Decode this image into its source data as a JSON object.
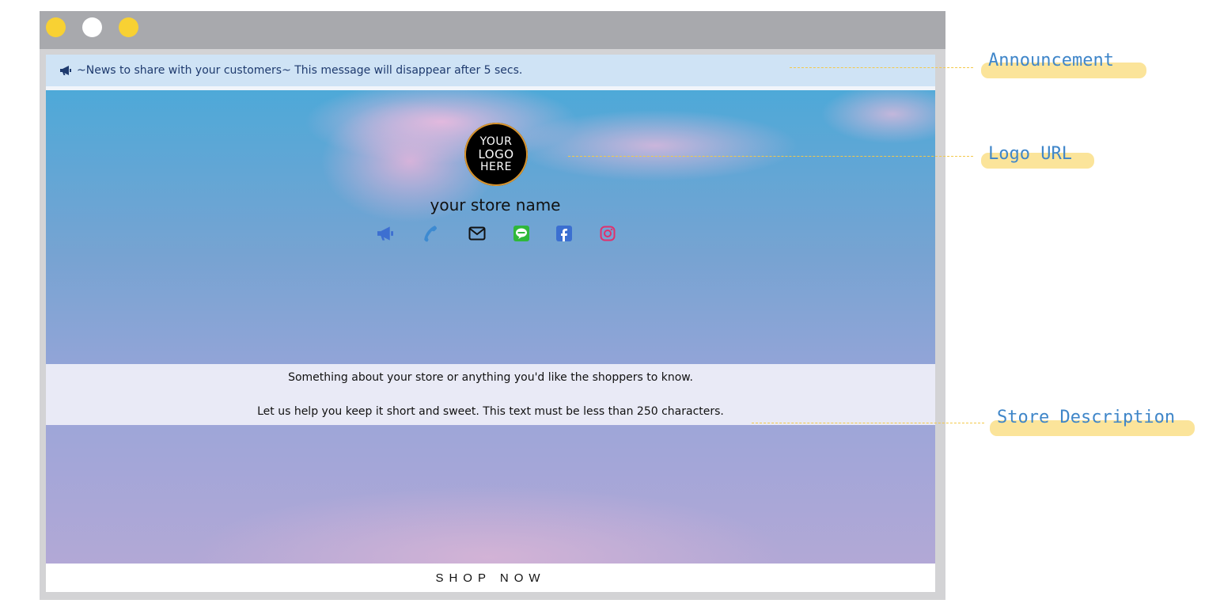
{
  "window": {
    "dots": [
      {
        "name": "window-dot-yellow-1",
        "color": "#f8d133"
      },
      {
        "name": "window-dot-white",
        "color": "#ffffff"
      },
      {
        "name": "window-dot-yellow-2",
        "color": "#f8d133"
      }
    ]
  },
  "announcement": {
    "text": "~News to share with your customers~ This message will disappear after 5 secs.",
    "icon": "megaphone-icon",
    "background": "#cfe3f5"
  },
  "logo": {
    "lines": [
      "YOUR",
      "LOGO",
      "HERE"
    ]
  },
  "store": {
    "name": "your store name"
  },
  "social_icons": [
    {
      "name": "megaphone-icon",
      "color": "#3d6fd1"
    },
    {
      "name": "phone-icon",
      "color": "#3d8ad1"
    },
    {
      "name": "mail-icon",
      "color": "#111111"
    },
    {
      "name": "line-icon",
      "color": "#2fb83a"
    },
    {
      "name": "facebook-icon",
      "color": "#3b6fd1"
    },
    {
      "name": "instagram-icon",
      "color": "#e1306c"
    }
  ],
  "description": {
    "line1": "Something about your store or anything you'd like the shoppers to know.",
    "line2": "Let us help you keep it short and sweet. This text must be less than 250 characters."
  },
  "shop_button": {
    "label": "SHOP NOW"
  },
  "annotations": {
    "announcement": "Announcement",
    "logo_url": "Logo URL",
    "store_description": "Store Description",
    "highlight_color": "#fbe49a",
    "text_color": "#3f86c9"
  }
}
